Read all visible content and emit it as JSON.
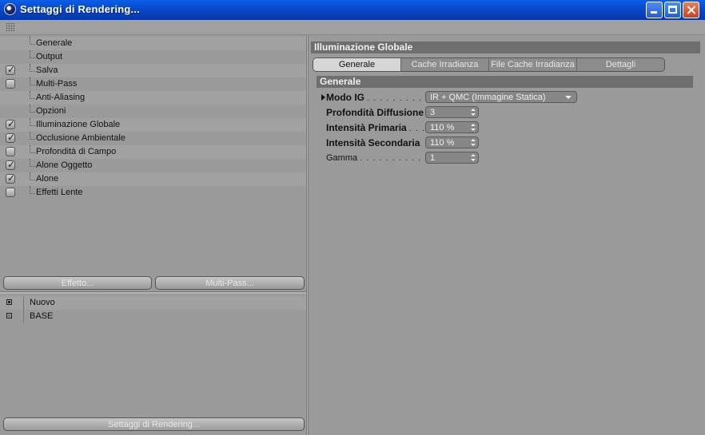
{
  "window": {
    "title": "Settaggi di Rendering..."
  },
  "tree": {
    "items": [
      {
        "label": "Generale",
        "checkbox": "none"
      },
      {
        "label": "Output",
        "checkbox": "none"
      },
      {
        "label": "Salva",
        "checkbox": "checked"
      },
      {
        "label": "Multi-Pass",
        "checkbox": "unchecked"
      },
      {
        "label": "Anti-Aliasing",
        "checkbox": "none"
      },
      {
        "label": "Opzioni",
        "checkbox": "none"
      },
      {
        "label": "Illuminazione Globale",
        "checkbox": "checked"
      },
      {
        "label": "Occlusione Ambientale",
        "checkbox": "checked"
      },
      {
        "label": "Profondità di Campo",
        "checkbox": "unchecked"
      },
      {
        "label": "Alone Oggetto",
        "checkbox": "checked"
      },
      {
        "label": "Alone",
        "checkbox": "checked"
      },
      {
        "label": "Effetti Lente",
        "checkbox": "unchecked"
      }
    ]
  },
  "buttons": {
    "effect": "Effetto...",
    "multipass": "Multi-Pass...",
    "render_settings": "Settaggi di Rendering..."
  },
  "presets": {
    "items": [
      {
        "label": "Nuovo"
      },
      {
        "label": "BASE"
      }
    ]
  },
  "panel": {
    "title": "Illuminazione Globale",
    "tabs": [
      "Generale",
      "Cache Irradianza",
      "File Cache Irradianza",
      "Dettagli"
    ],
    "active_tab": "Generale",
    "section": "Generale",
    "params": [
      {
        "label": "Modo IG",
        "dots": ". . . . . . . . . . .",
        "value": "IR + QMC (Immagine Statica)",
        "control": "dropdown"
      },
      {
        "label": "Profondità Diffusione",
        "dots": "",
        "value": "3",
        "control": "stepper"
      },
      {
        "label": "Intensità Primaria",
        "dots": ". . .",
        "value": "110 %",
        "control": "stepper"
      },
      {
        "label": "Intensità Secondaria",
        "dots": "",
        "value": "110 %",
        "control": "stepper"
      },
      {
        "label": "Gamma",
        "dots": ". . . . . . . . . . . . . .",
        "value": "1",
        "control": "stepper"
      }
    ]
  }
}
